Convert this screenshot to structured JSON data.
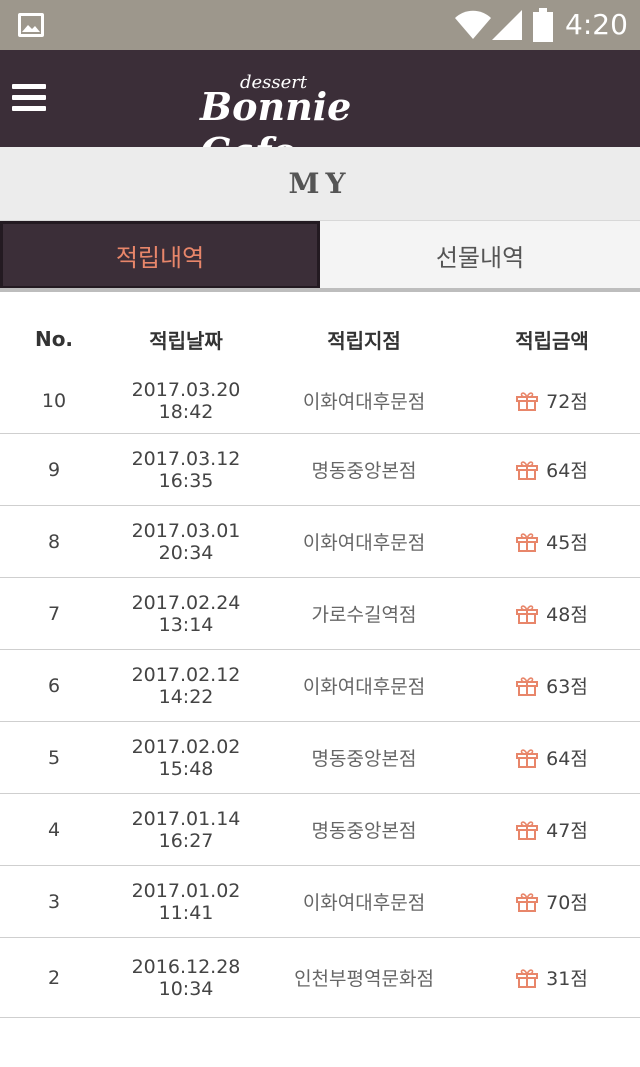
{
  "status_bar": {
    "time": "4:20",
    "icons": [
      "image-icon",
      "wifi-icon",
      "signal-icon",
      "battery-icon"
    ]
  },
  "header": {
    "menu_icon": "hamburger-menu-icon",
    "logo_small": "dessert",
    "logo_main": "Bonnie Cafe"
  },
  "page": {
    "title": "MY"
  },
  "tabs": [
    {
      "label": "적립내역",
      "active": true
    },
    {
      "label": "선물내역",
      "active": false
    }
  ],
  "table": {
    "headers": {
      "no": "No.",
      "date": "적립날짜",
      "branch": "적립지점",
      "amount": "적립금액"
    },
    "rows": [
      {
        "no": "10",
        "date": "2017.03.20 18:42",
        "branch": "이화여대후문점",
        "amount": "72점"
      },
      {
        "no": "9",
        "date": "2017.03.12 16:35",
        "branch": "명동중앙본점",
        "amount": "64점"
      },
      {
        "no": "8",
        "date": "2017.03.01 20:34",
        "branch": "이화여대후문점",
        "amount": "45점"
      },
      {
        "no": "7",
        "date": "2017.02.24 13:14",
        "branch": "가로수길역점",
        "amount": "48점"
      },
      {
        "no": "6",
        "date": "2017.02.12 14:22",
        "branch": "이화여대후문점",
        "amount": "63점"
      },
      {
        "no": "5",
        "date": "2017.02.02 15:48",
        "branch": "명동중앙본점",
        "amount": "64점"
      },
      {
        "no": "4",
        "date": "2017.01.14 16:27",
        "branch": "명동중앙본점",
        "amount": "47점"
      },
      {
        "no": "3",
        "date": "2017.01.02 11:41",
        "branch": "이화여대후문점",
        "amount": "70점"
      },
      {
        "no": "2",
        "date": "2016.12.28 10:34",
        "branch": "인천부평역문화점",
        "amount": "31점"
      }
    ]
  },
  "colors": {
    "header_bg": "#3b2e38",
    "accent": "#e8866a",
    "status_bar_bg": "#9d978c"
  }
}
